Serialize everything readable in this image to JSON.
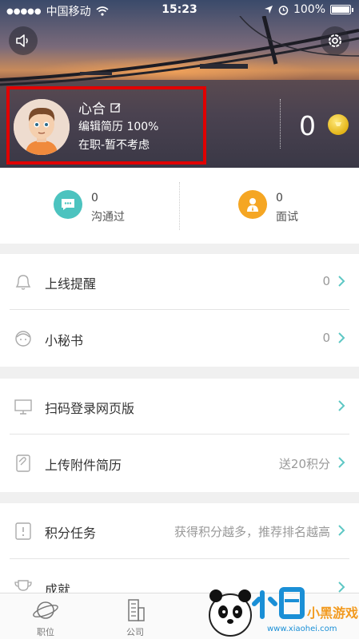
{
  "status_bar": {
    "carrier": "中国移动",
    "time": "15:23",
    "battery": "100%"
  },
  "profile": {
    "name": "心合",
    "resume_text": "编辑简历 100%",
    "job_status": "在职-暂不考虑",
    "coins": "0"
  },
  "stats": [
    {
      "count": "0",
      "label": "沟通过"
    },
    {
      "count": "0",
      "label": "面试"
    }
  ],
  "list": {
    "reminder": {
      "label": "上线提醒",
      "value": "0"
    },
    "secretary": {
      "label": "小秘书",
      "value": "0"
    },
    "scan_login": {
      "label": "扫码登录网页版",
      "value": ""
    },
    "upload_resume": {
      "label": "上传附件简历",
      "value": "送20积分"
    },
    "points_task": {
      "label": "积分任务",
      "value": "获得积分越多，推荐排名越高"
    },
    "achievement": {
      "label": "成就",
      "value": ""
    }
  },
  "tabbar": [
    {
      "label": "职位"
    },
    {
      "label": "公司"
    }
  ],
  "watermark": {
    "brand": "小黑游戏",
    "url": "www.xiaohei.com"
  },
  "colors": {
    "teal": "#4cc3bf",
    "orange": "#f5a623",
    "highlight_border": "#e00000",
    "chevron": "#5ec7c4"
  }
}
